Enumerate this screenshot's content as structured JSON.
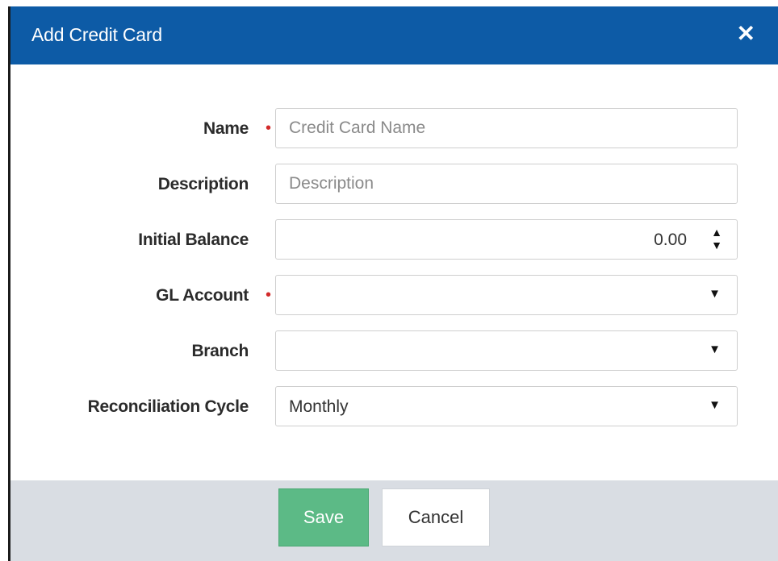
{
  "dialog": {
    "title": "Add Credit Card",
    "close_glyph": "✕"
  },
  "form": {
    "name": {
      "label": "Name",
      "placeholder": "Credit Card Name",
      "required_mark": "•"
    },
    "description": {
      "label": "Description",
      "placeholder": "Description"
    },
    "initial_balance": {
      "label": "Initial Balance",
      "value": "0.00",
      "spin_up": "▲",
      "spin_down": "▼"
    },
    "gl_account": {
      "label": "GL Account",
      "value": "",
      "required_mark": "•",
      "caret": "▼"
    },
    "branch": {
      "label": "Branch",
      "value": "",
      "caret": "▼"
    },
    "reconciliation_cycle": {
      "label": "Reconciliation Cycle",
      "value": "Monthly",
      "caret": "▼"
    }
  },
  "footer": {
    "save_label": "Save",
    "cancel_label": "Cancel"
  },
  "colors": {
    "header": "#0d5ba6",
    "save": "#5cba86",
    "required": "#d22a2a",
    "footer": "#d9dde3"
  },
  "icons": [
    "close-icon",
    "spin-up-icon",
    "spin-down-icon",
    "chevron-down-icon"
  ]
}
